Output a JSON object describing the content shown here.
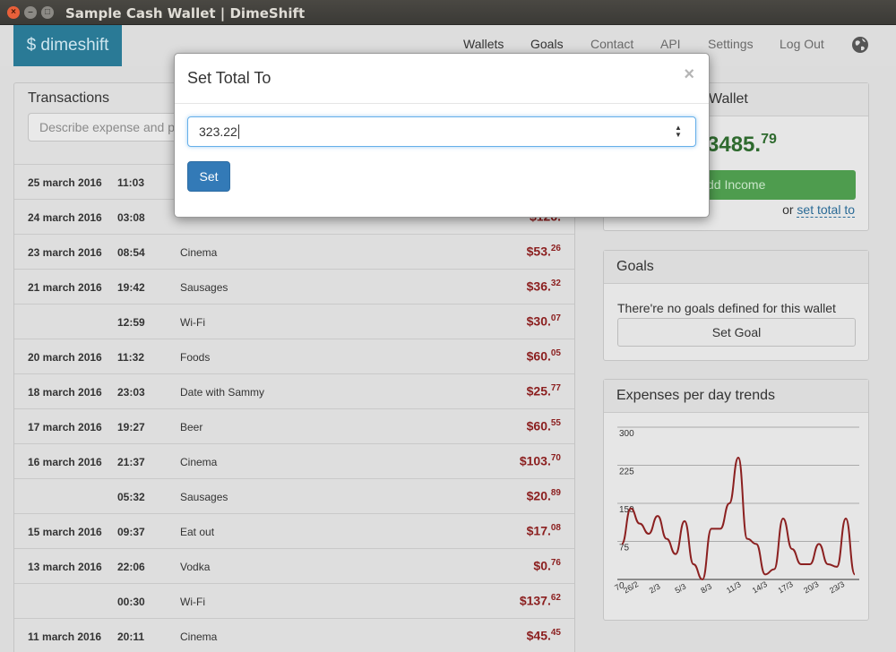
{
  "window": {
    "title": "Sample Cash Wallet | DimeShift",
    "close_glyph": "×",
    "min_glyph": "–",
    "max_glyph": "□"
  },
  "navbar": {
    "brand": "$ dimeshift",
    "links": [
      "Wallets",
      "Goals",
      "Contact",
      "API",
      "Settings",
      "Log Out"
    ],
    "globe_icon": "globe-icon"
  },
  "transactions": {
    "title": "Transactions",
    "search_placeholder": "Describe expense and p",
    "rows": [
      {
        "date": "25 march 2016",
        "time": "11:03",
        "desc": "",
        "amount": "",
        "cents": ""
      },
      {
        "date": "24 march 2016",
        "time": "03:08",
        "desc": "",
        "amount": "$126.",
        "cents": ""
      },
      {
        "date": "23 march 2016",
        "time": "08:54",
        "desc": "Cinema",
        "amount": "$53.",
        "cents": "26"
      },
      {
        "date": "21 march 2016",
        "time": "19:42",
        "desc": "Sausages",
        "amount": "$36.",
        "cents": "32"
      },
      {
        "date": "",
        "time": "12:59",
        "desc": "Wi-Fi",
        "amount": "$30.",
        "cents": "07"
      },
      {
        "date": "20 march 2016",
        "time": "11:32",
        "desc": "Foods",
        "amount": "$60.",
        "cents": "05"
      },
      {
        "date": "18 march 2016",
        "time": "23:03",
        "desc": "Date with Sammy",
        "amount": "$25.",
        "cents": "77"
      },
      {
        "date": "17 march 2016",
        "time": "19:27",
        "desc": "Beer",
        "amount": "$60.",
        "cents": "55"
      },
      {
        "date": "16 march 2016",
        "time": "21:37",
        "desc": "Cinema",
        "amount": "$103.",
        "cents": "70"
      },
      {
        "date": "",
        "time": "05:32",
        "desc": "Sausages",
        "amount": "$20.",
        "cents": "89"
      },
      {
        "date": "15 march 2016",
        "time": "09:37",
        "desc": "Eat out",
        "amount": "$17.",
        "cents": "08"
      },
      {
        "date": "13 march 2016",
        "time": "22:06",
        "desc": "Vodka",
        "amount": "$0.",
        "cents": "76"
      },
      {
        "date": "",
        "time": "00:30",
        "desc": "Wi-Fi",
        "amount": "$137.",
        "cents": "62"
      },
      {
        "date": "11 march 2016",
        "time": "20:11",
        "desc": "Cinema",
        "amount": "$45.",
        "cents": "45"
      }
    ]
  },
  "wallet": {
    "title_fragment": "Wallet",
    "total_main": "3485.",
    "total_cents": "79",
    "add_income_label": "dd Income",
    "or_text": "or",
    "set_total_link": "set total to"
  },
  "goals": {
    "title": "Goals",
    "empty_text": "There're no goals defined for this wallet",
    "set_goal_label": "Set Goal"
  },
  "trends": {
    "title": "Expenses per day trends"
  },
  "chart_data": {
    "type": "line",
    "title": "Expenses per day trends",
    "yticks": [
      "300",
      "225",
      "150",
      "75",
      "0"
    ],
    "ylim": [
      0,
      300
    ],
    "xticks": [
      "26/2",
      "2/3",
      "5/3",
      "8/3",
      "11/3",
      "14/3",
      "17/3",
      "20/3",
      "23/3"
    ],
    "first_xtick_partial": "7",
    "series": [
      {
        "color": "#8b2020",
        "values": [
          70,
          140,
          110,
          90,
          125,
          80,
          50,
          115,
          30,
          0,
          100,
          100,
          150,
          240,
          80,
          70,
          10,
          20,
          120,
          60,
          30,
          30,
          70,
          30,
          25,
          120,
          10
        ]
      }
    ],
    "grid": true
  },
  "modal": {
    "title": "Set Total To",
    "close_glyph": "×",
    "input_value": "323.22",
    "set_label": "Set",
    "spinner_up": "▲",
    "spinner_down": "▼"
  }
}
